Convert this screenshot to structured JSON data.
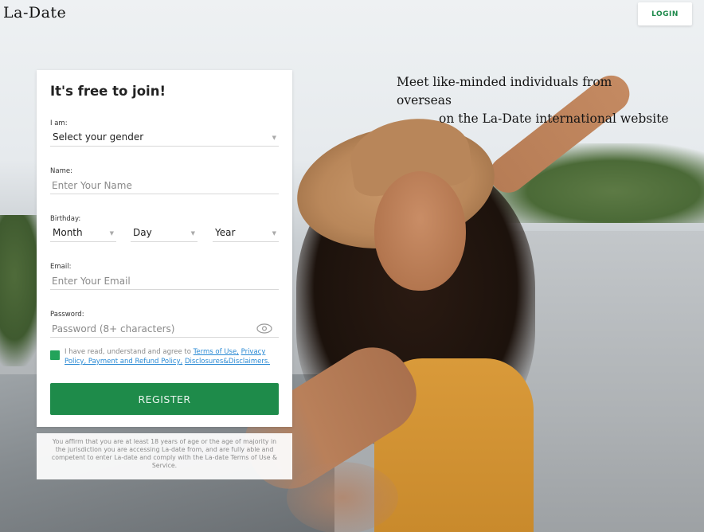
{
  "header": {
    "logo": "La-Date",
    "login_label": "LOGIN"
  },
  "tagline": {
    "line1": "Meet like-minded individuals from",
    "line2": "overseas",
    "line3": "on the La-Date international website"
  },
  "form": {
    "title": "It's free to join!",
    "gender": {
      "label": "I am:",
      "value": "Select your gender"
    },
    "name": {
      "label": "Name:",
      "placeholder": "Enter Your Name"
    },
    "birthday": {
      "label": "Birthday:",
      "month": "Month",
      "day": "Day",
      "year": "Year"
    },
    "email": {
      "label": "Email:",
      "placeholder": "Enter Your Email"
    },
    "password": {
      "label": "Password:",
      "placeholder": "Password (8+ characters)"
    },
    "agree": {
      "checked": true,
      "text": "I have read, understand and agree to",
      "links": [
        "Terms of Use,",
        "Privacy Policy, Payment and Refund Policy,",
        "Disclosures&Disclaimers."
      ]
    },
    "register_label": "REGISTER"
  },
  "disclaimer": "You affirm that you are at least 18 years of age or the age of majority in the jurisdiction you are accessing La-date from, and are fully able and competent to enter La-date and comply with the La-date Terms of Use & Service.",
  "colors": {
    "accent": "#1e8b4a",
    "checkbox": "#22a35a",
    "link": "#2a8ad4"
  }
}
